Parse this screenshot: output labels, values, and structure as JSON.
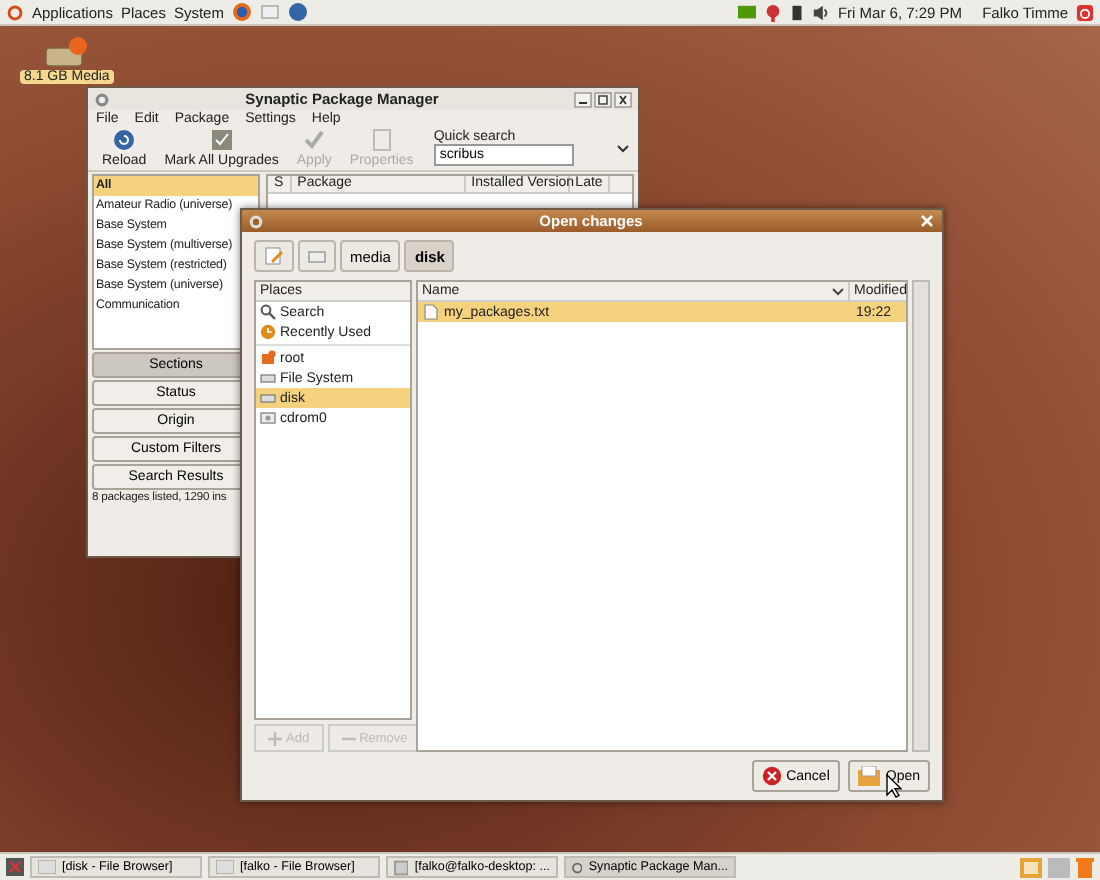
{
  "top_panel": {
    "menus": [
      "Applications",
      "Places",
      "System"
    ],
    "clock": "Fri Mar  6,  7:29 PM",
    "user": "Falko Timme"
  },
  "desktop_icons": [
    {
      "label": "8.1 GB Media"
    }
  ],
  "synaptic": {
    "title": "Synaptic Package Manager",
    "menu": [
      "File",
      "Edit",
      "Package",
      "Settings",
      "Help"
    ],
    "toolbar": [
      {
        "label": "Reload",
        "kind": "reload",
        "disabled": false
      },
      {
        "label": "Mark All Upgrades",
        "kind": "upgrade",
        "disabled": false
      },
      {
        "label": "Apply",
        "kind": "apply",
        "disabled": true
      },
      {
        "label": "Properties",
        "kind": "properties",
        "disabled": true
      }
    ],
    "quick_search": {
      "label": "Quick search",
      "value": "scribus"
    },
    "sections": [
      {
        "label": "All",
        "selected": true
      },
      {
        "label": "Amateur Radio (universe)",
        "selected": false
      },
      {
        "label": "Base System",
        "selected": false
      },
      {
        "label": "Base System (multiverse)",
        "selected": false
      },
      {
        "label": "Base System (restricted)",
        "selected": false
      },
      {
        "label": "Base System (universe)",
        "selected": false
      },
      {
        "label": "Communication",
        "selected": false
      }
    ],
    "columns": [
      "S",
      "Package",
      "Installed Version",
      "Late"
    ],
    "filter_buttons": [
      {
        "label": "Sections",
        "selected": true
      },
      {
        "label": "Status",
        "selected": false
      },
      {
        "label": "Origin",
        "selected": false
      },
      {
        "label": "Custom Filters",
        "selected": false
      },
      {
        "label": "Search Results",
        "selected": false
      }
    ],
    "status_bar": "8 packages listed, 1290 ins"
  },
  "dialog": {
    "title": "Open changes",
    "path": [
      {
        "label": "media",
        "selected": false
      },
      {
        "label": "disk",
        "selected": true
      }
    ],
    "places_header": "Places",
    "place_groups": [
      [
        {
          "label": "Search",
          "kind": "search",
          "selected": false
        },
        {
          "label": "Recently Used",
          "kind": "recent",
          "selected": false
        }
      ],
      [
        {
          "label": "root",
          "kind": "home",
          "selected": false
        },
        {
          "label": "File System",
          "kind": "drive",
          "selected": false
        },
        {
          "label": "disk",
          "kind": "drive",
          "selected": true
        },
        {
          "label": "cdrom0",
          "kind": "cdrom",
          "selected": false
        }
      ]
    ],
    "place_buttons": [
      {
        "label": "Add",
        "kind": "add",
        "disabled": true
      },
      {
        "label": "Remove",
        "kind": "remove",
        "disabled": true
      }
    ],
    "file_columns": [
      "Name",
      "Modified"
    ],
    "files": [
      {
        "name": "my_packages.txt",
        "modified": "19:22",
        "selected": true
      }
    ],
    "buttons": [
      {
        "label": "Cancel",
        "kind": "cancel"
      },
      {
        "label": "Open",
        "kind": "open"
      }
    ]
  },
  "taskbar": [
    {
      "label": "[disk - File Browser]",
      "kind": "folder",
      "selected": false
    },
    {
      "label": "[falko - File Browser]",
      "kind": "folder",
      "selected": false
    },
    {
      "label": "[falko@falko-desktop: ...",
      "kind": "terminal",
      "selected": false
    },
    {
      "label": "Synaptic Package Man...",
      "kind": "synaptic",
      "selected": true
    }
  ]
}
